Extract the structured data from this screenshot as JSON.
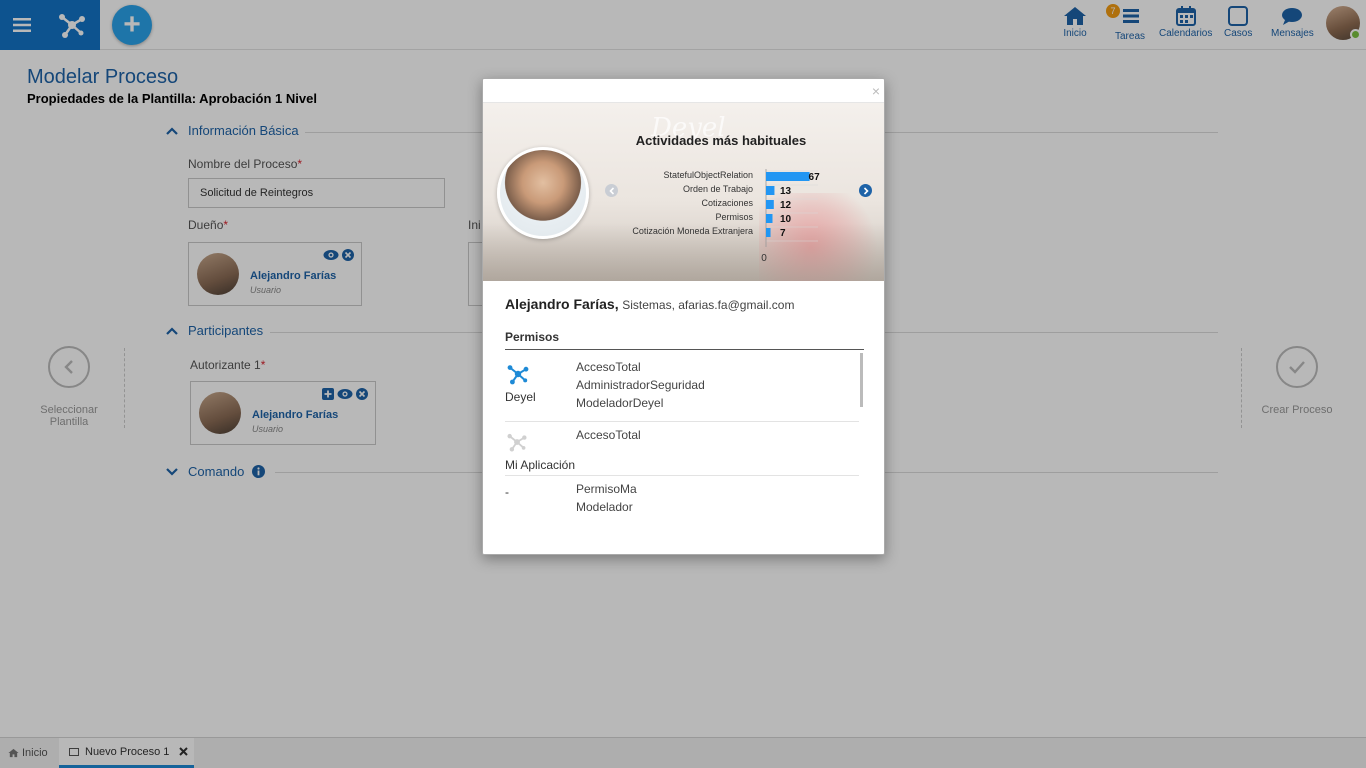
{
  "topbar": {
    "nav": [
      {
        "id": "inicio",
        "label": "Inicio"
      },
      {
        "id": "tareas",
        "label": "Tareas",
        "badge": "7"
      },
      {
        "id": "calendarios",
        "label": "Calendarios"
      },
      {
        "id": "casos",
        "label": "Casos"
      },
      {
        "id": "mensajes",
        "label": "Mensajes"
      }
    ],
    "add_label": "+"
  },
  "page": {
    "title": "Modelar Proceso",
    "subtitle": "Propiedades de la Plantilla: Aprobación 1 Nivel",
    "sections": {
      "info": "Información Básica",
      "participantes": "Participantes",
      "comando": "Comando"
    },
    "nombre_label": "Nombre del Proceso",
    "nombre_value": "Solicitud de Reintegros",
    "dueno_label": "Dueño",
    "hidden_label_fragment": "Ini",
    "autorizante_label": "Autorizante 1",
    "required_mark": "*",
    "owner": {
      "name": "Alejandro Farías",
      "role": "Usuario"
    },
    "authorizer": {
      "name": "Alejandro Farías",
      "role": "Usuario"
    },
    "left_action": {
      "line1": "Seleccionar",
      "line2": "Plantilla"
    },
    "right_action": {
      "label": "Crear Proceso"
    }
  },
  "bottom_tabs": [
    {
      "label": "Inicio"
    },
    {
      "label": "Nuevo Proceso 1"
    }
  ],
  "modal": {
    "close": "×",
    "watermark": "Deyel",
    "chart_title": "Actividades más habituales",
    "person": {
      "name": "Alejandro Farías,",
      "meta": "Sistemas, afarias.fa@gmail.com"
    },
    "permisos_title": "Permisos",
    "permisos": [
      {
        "app": "Deyel",
        "values": [
          "AccesoTotal",
          "AdministradorSeguridad",
          "ModeladorDeyel"
        ]
      },
      {
        "app": "Mi Aplicación",
        "values": [
          "AccesoTotal"
        ]
      },
      {
        "app": "-",
        "values": [
          "PermisoMa",
          "Modelador"
        ]
      }
    ]
  },
  "chart_data": {
    "type": "bar",
    "orientation": "horizontal",
    "title": "Actividades más habituales",
    "categories": [
      "StatefulObjectRelation",
      "Orden de Trabajo",
      "Cotizaciones",
      "Permisos",
      "Cotización Moneda Extranjera"
    ],
    "values": [
      67,
      13,
      12,
      10,
      7
    ],
    "xlim": [
      0,
      80
    ],
    "x_tick_labels": [
      "0"
    ],
    "color": "#2196f3"
  },
  "colors": {
    "brand": "#1373c7",
    "accent": "#2aa3ea",
    "link": "#1e63a8",
    "badge": "#f39c12",
    "required": "#d9232f",
    "online": "#7cc241"
  }
}
